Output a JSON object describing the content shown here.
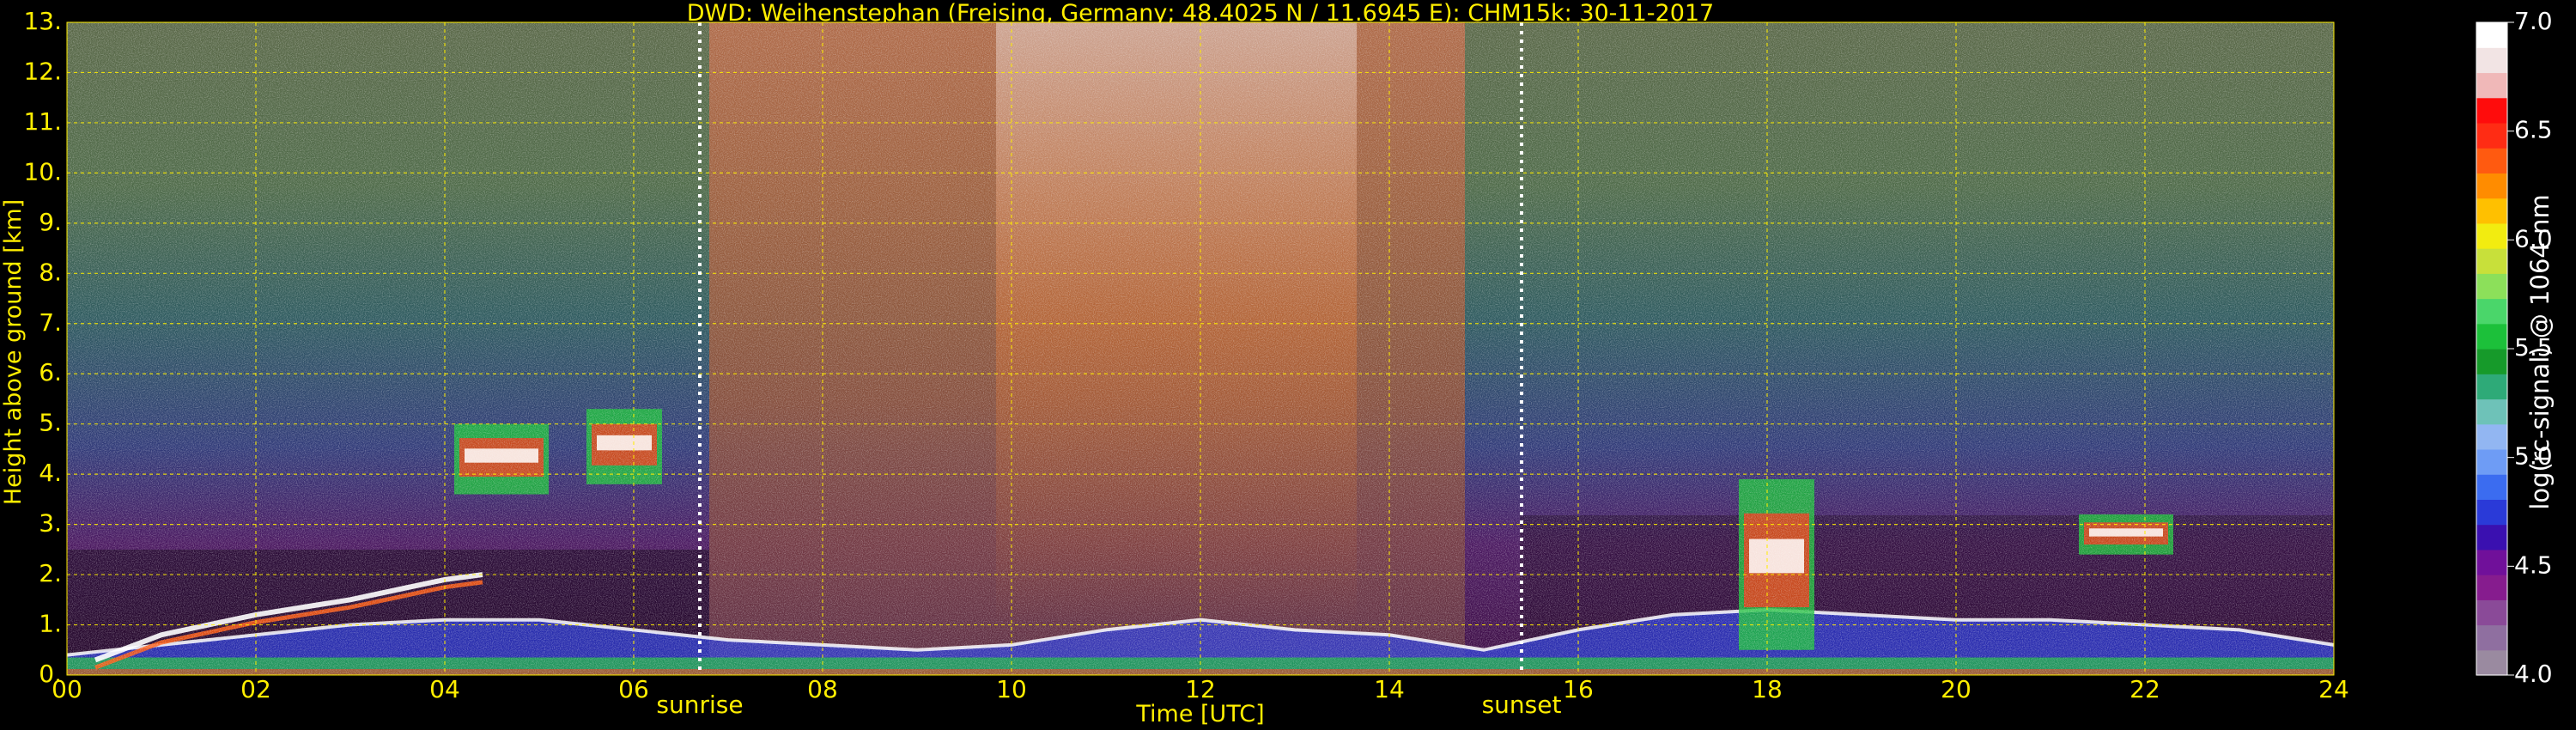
{
  "chart_data": {
    "type": "heatmap",
    "title": "DWD: Weihenstephan (Freising, Germany; 48.4025 N / 11.6945 E):    CHM15k: 30-11-2017",
    "xlabel": "Time [UTC]",
    "ylabel": "Height above ground [km]",
    "xlim": [
      0,
      24
    ],
    "ylim": [
      0,
      13
    ],
    "x_ticks": [
      "00",
      "02",
      "04",
      "06",
      "08",
      "10",
      "12",
      "14",
      "16",
      "18",
      "20",
      "22",
      "24"
    ],
    "y_ticks": [
      "0.",
      "1.",
      "2.",
      "3.",
      "4.",
      "5.",
      "6.",
      "7.",
      "8.",
      "9.",
      "10.",
      "11.",
      "12.",
      "13."
    ],
    "grid": true,
    "grid_color": "#ffee00",
    "annotations": [
      {
        "label": "sunrise",
        "x": 6.7
      },
      {
        "label": "sunset",
        "x": 15.4
      }
    ],
    "colorbar": {
      "label": "log(rc-signal) @ 1064 nm",
      "range": [
        4.0,
        7.0
      ],
      "ticks": [
        "4.0",
        "4.5",
        "5.0",
        "5.5",
        "6.0",
        "6.5",
        "7.0"
      ],
      "colors": [
        "#9a8aa0",
        "#8f6fa0",
        "#8a4a98",
        "#861c8e",
        "#70109a",
        "#3a10b0",
        "#2a3ad8",
        "#3b6cf0",
        "#6e9cf5",
        "#92b6f2",
        "#6ec2b8",
        "#2eaa78",
        "#169a2a",
        "#1cc03a",
        "#4ad66a",
        "#8ce05a",
        "#c8e03a",
        "#f2ec10",
        "#ffc000",
        "#ff8c00",
        "#ff5a10",
        "#ff2c14",
        "#ff0c0c",
        "#f0b8b8",
        "#f2e4e4",
        "#ffffff"
      ]
    },
    "layers": [
      {
        "name": "boundary layer (near ground)",
        "values": [
          [
            0,
            0.4
          ],
          [
            1,
            0.6
          ],
          [
            2,
            0.8
          ],
          [
            3,
            1.0
          ],
          [
            4,
            1.1
          ],
          [
            5,
            1.1
          ],
          [
            6,
            0.9
          ],
          [
            7,
            0.7
          ],
          [
            8,
            0.6
          ],
          [
            9,
            0.5
          ],
          [
            10,
            0.6
          ],
          [
            11,
            0.9
          ],
          [
            12,
            1.1
          ],
          [
            13,
            0.9
          ],
          [
            14,
            0.8
          ],
          [
            15,
            0.5
          ],
          [
            16,
            0.9
          ],
          [
            17,
            1.2
          ],
          [
            18,
            1.3
          ],
          [
            19,
            1.2
          ],
          [
            20,
            1.1
          ],
          [
            21,
            1.1
          ],
          [
            22,
            1.0
          ],
          [
            23,
            0.9
          ],
          [
            24,
            0.6
          ]
        ]
      },
      {
        "name": "rising aerosol / cloud base",
        "values": [
          [
            0.3,
            0.3
          ],
          [
            1.0,
            0.8
          ],
          [
            2.0,
            1.2
          ],
          [
            3.0,
            1.5
          ],
          [
            3.5,
            1.7
          ],
          [
            4.0,
            1.9
          ],
          [
            4.4,
            2.0
          ]
        ]
      },
      {
        "name": "cloud 04-05 UTC",
        "x_range": [
          4.1,
          5.1
        ],
        "base": 3.6,
        "top": 5.0
      },
      {
        "name": "cloud 05.5-06.3 UTC",
        "x_range": [
          5.5,
          6.3
        ],
        "base": 3.8,
        "top": 5.3
      },
      {
        "name": "convective layer 17.7-18.5 UTC",
        "x_range": [
          17.7,
          18.5
        ],
        "base": 0.5,
        "top": 3.9
      },
      {
        "name": "cloud 21.3-22.3 UTC",
        "x_range": [
          21.3,
          22.3
        ],
        "base": 2.4,
        "top": 3.2
      }
    ]
  }
}
